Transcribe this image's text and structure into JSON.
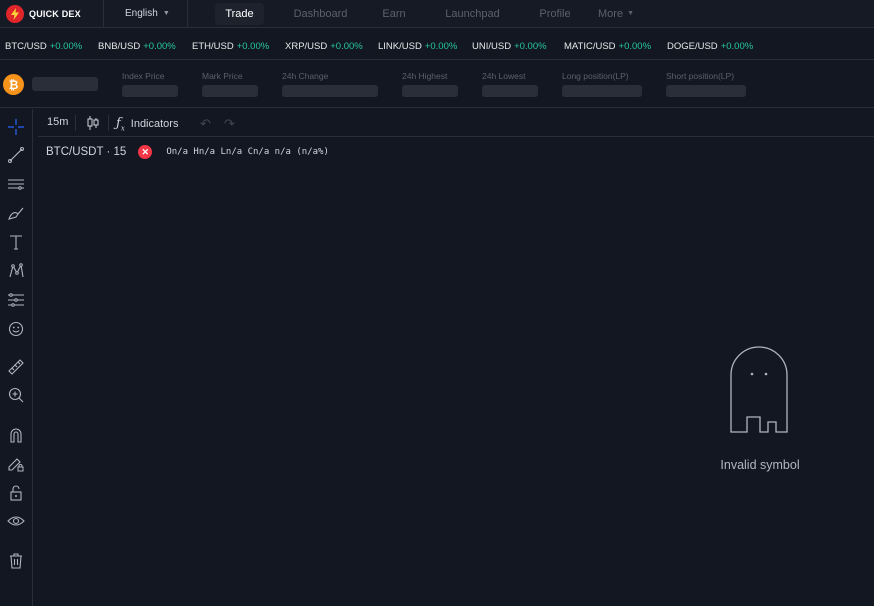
{
  "header": {
    "logo_text": "QUICK DEX",
    "language": "English",
    "nav": [
      {
        "label": "Trade"
      },
      {
        "label": "Dashboard"
      },
      {
        "label": "Earn"
      },
      {
        "label": "Launchpad"
      },
      {
        "label": "Profile"
      },
      {
        "label": "More"
      }
    ],
    "active_nav": "Trade"
  },
  "ticker": [
    {
      "pair": "BTC/USD",
      "change": "+0.00%"
    },
    {
      "pair": "BNB/USD",
      "change": "+0.00%"
    },
    {
      "pair": "ETH/USD",
      "change": "+0.00%"
    },
    {
      "pair": "XRP/USD",
      "change": "+0.00%"
    },
    {
      "pair": "LINK/USD",
      "change": "+0.00%"
    },
    {
      "pair": "UNI/USD",
      "change": "+0.00%"
    },
    {
      "pair": "MATIC/USD",
      "change": "+0.00%"
    },
    {
      "pair": "DOGE/USD",
      "change": "+0.00%"
    }
  ],
  "stats": {
    "coin_glyph": "₿",
    "labels": [
      "Index Price",
      "Mark Price",
      "24h Change",
      "24h Highest",
      "24h Lowest",
      "Long position(LP)",
      "Short position(LP)"
    ]
  },
  "chart": {
    "interval": "15m",
    "indicators_label": "Indicators",
    "symbol": "BTC/USDT · 15",
    "ohlc": "On/a Hn/a Ln/a Cn/a n/a (n/a%)",
    "error_glyph": "✕",
    "invalid_message": "Invalid symbol"
  },
  "colors": {
    "background": "#131722",
    "positive": "#26c6a0",
    "error": "#f23645",
    "brand": "#e0262b",
    "bitcoin": "#f7931a"
  }
}
